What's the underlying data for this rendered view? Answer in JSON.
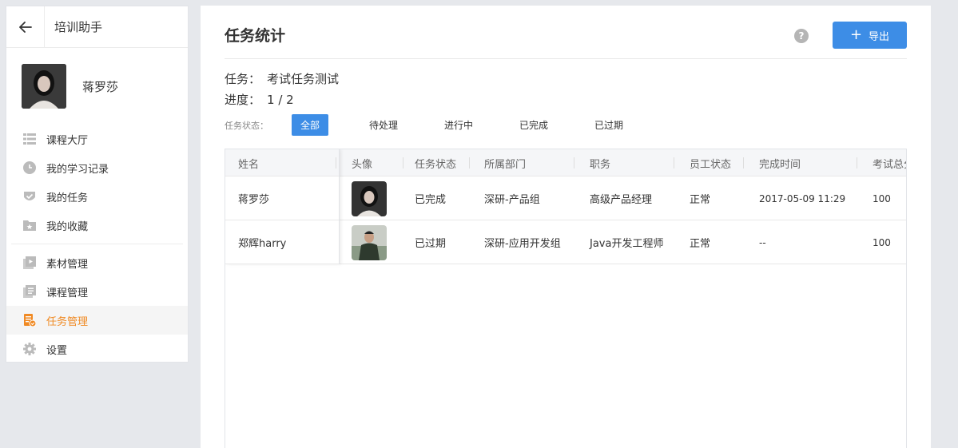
{
  "sidebar": {
    "title": "培训助手",
    "user_name": "蒋罗莎",
    "menu_group1": [
      {
        "label": "课程大厅",
        "icon": "list-icon"
      },
      {
        "label": "我的学习记录",
        "icon": "clock-icon"
      },
      {
        "label": "我的任务",
        "icon": "shield-check-icon"
      },
      {
        "label": "我的收藏",
        "icon": "folder-star-icon"
      }
    ],
    "menu_group2": [
      {
        "label": "素材管理",
        "icon": "media-icon"
      },
      {
        "label": "课程管理",
        "icon": "docs-icon"
      },
      {
        "label": "任务管理",
        "icon": "task-doc-icon",
        "active": true
      },
      {
        "label": "设置",
        "icon": "gear-icon"
      }
    ]
  },
  "main": {
    "title": "任务统计",
    "export_label": "导出",
    "help_glyph": "?",
    "task_label": "任务：",
    "task_value": "考试任务测试",
    "progress_label": "进度：",
    "progress_value": "1 / 2",
    "filter_label": "任务状态：",
    "filters": [
      "全部",
      "待处理",
      "进行中",
      "已完成",
      "已过期"
    ],
    "active_filter": "全部"
  },
  "table": {
    "headers": [
      "姓名",
      "头像",
      "任务状态",
      "所属部门",
      "职务",
      "员工状态",
      "完成时间",
      "考试总分"
    ],
    "rows": [
      {
        "name": "蒋罗莎",
        "status": "已完成",
        "department": "深研-产品组",
        "position": "高级产品经理",
        "employee_status": "正常",
        "completed_at": "2017-05-09 11:29",
        "score": "100"
      },
      {
        "name": "郑辉harry",
        "status": "已过期",
        "department": "深研-应用开发组",
        "position": "Java开发工程师",
        "employee_status": "正常",
        "completed_at": "--",
        "score": "100"
      }
    ]
  },
  "colors": {
    "accent": "#3d8de6",
    "active_menu": "#f08a24",
    "background": "#e6e8ec"
  }
}
